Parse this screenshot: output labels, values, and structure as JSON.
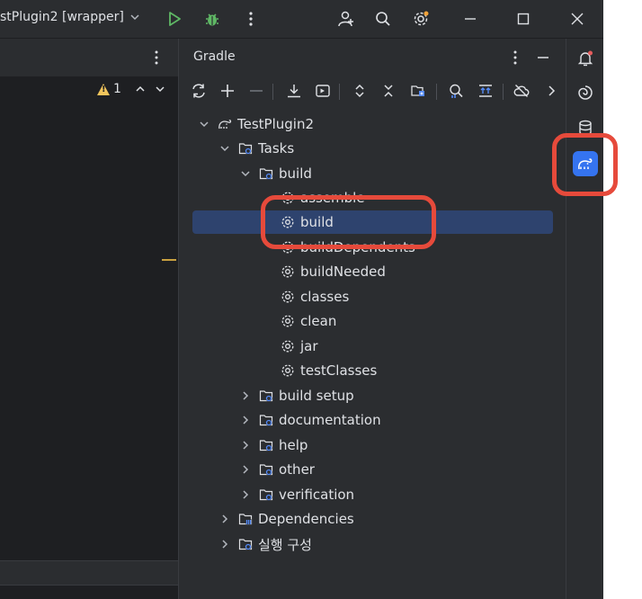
{
  "titlebar": {
    "run_config": "stPlugin2 [wrapper]",
    "icons": [
      "run-icon",
      "debug-icon",
      "more-icon",
      "add-user-icon",
      "search-icon",
      "settings-icon",
      "minimize-icon",
      "maximize-icon",
      "close-icon"
    ]
  },
  "editor": {
    "warning_count": "1"
  },
  "gradle": {
    "title": "Gradle",
    "toolbar_icons": [
      "refresh-icon",
      "add-icon",
      "remove-icon",
      "download-sources-icon",
      "run-task-icon",
      "expand-all-icon",
      "collapse-all-icon",
      "group-modules-icon",
      "analyze-dependencies-icon",
      "toggle-tasks-icon",
      "offline-mode-icon",
      "more-chevron-icon"
    ],
    "tree": {
      "project": "TestPlugin2",
      "tasks": "Tasks",
      "build_group": "build",
      "assemble": "assemble",
      "build": "build",
      "buildDependents": "buildDependents",
      "buildNeeded": "buildNeeded",
      "classes": "classes",
      "clean": "clean",
      "jar": "jar",
      "testClasses": "testClasses",
      "build_setup": "build setup",
      "documentation": "documentation",
      "help": "help",
      "other": "other",
      "verification": "verification",
      "dependencies": "Dependencies",
      "run_configurations": "실행 구성"
    }
  },
  "strip": {
    "icons": [
      "notifications-icon",
      "ai-assistant-icon",
      "database-icon",
      "gradle-icon"
    ],
    "accent": "#3574f0"
  },
  "colors": {
    "highlight": "#e64a3b",
    "selection": "#2e436e",
    "run_green": "#5fb865"
  }
}
